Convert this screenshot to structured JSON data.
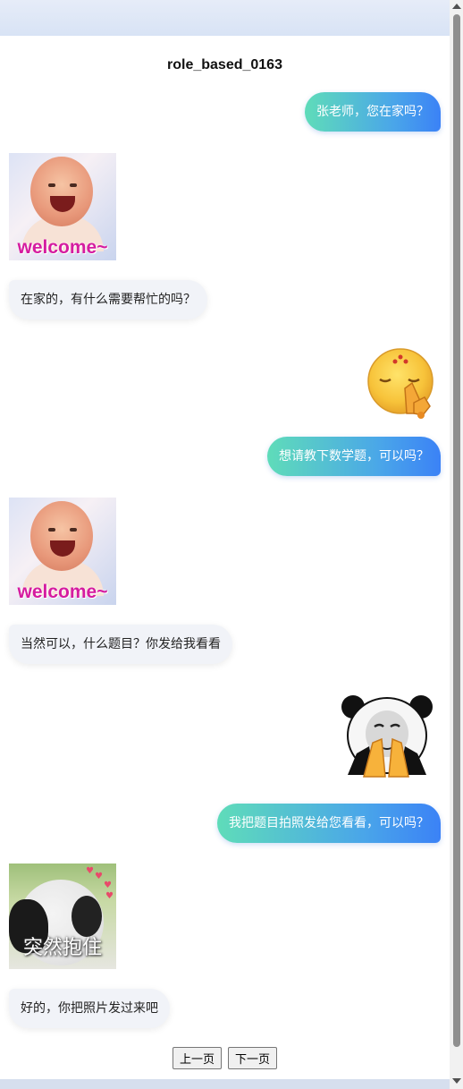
{
  "chat": {
    "title": "role_based_0163",
    "messages": [
      {
        "role": "user",
        "type": "text",
        "text": "张老师，您在家吗？"
      },
      {
        "role": "bot",
        "type": "sticker",
        "sticker": "welcome-baby-sticker",
        "caption": "welcome~"
      },
      {
        "role": "bot",
        "type": "text",
        "text": "在家的，有什么需要帮忙的吗？"
      },
      {
        "role": "user",
        "type": "sticker",
        "sticker": "praying-emoji-sticker"
      },
      {
        "role": "user",
        "type": "text",
        "text": "想请教下数学题，可以吗？"
      },
      {
        "role": "bot",
        "type": "sticker",
        "sticker": "welcome-baby-sticker",
        "caption": "welcome~"
      },
      {
        "role": "bot",
        "type": "text",
        "text": "当然可以，什么题目？你发给我看看"
      },
      {
        "role": "user",
        "type": "sticker",
        "sticker": "panda-praying-hands-sticker"
      },
      {
        "role": "user",
        "type": "text",
        "text": "我把题目拍照发给您看看，可以吗？"
      },
      {
        "role": "bot",
        "type": "sticker",
        "sticker": "panda-hug-sticker",
        "caption": "突然抱住"
      },
      {
        "role": "bot",
        "type": "text",
        "text": "好的，你把照片发过来吧"
      }
    ]
  },
  "pager": {
    "prev_label": "上一页",
    "next_label": "下一页"
  },
  "colors": {
    "user_bubble_start": "#5fdcb9",
    "user_bubble_end": "#3b82f6",
    "bot_bubble": "#f1f3f8",
    "welcome_text": "#d51ca0"
  }
}
